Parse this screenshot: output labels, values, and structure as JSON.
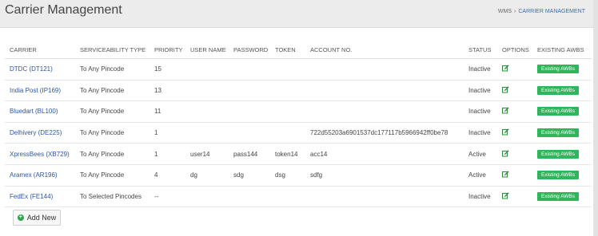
{
  "header": {
    "title": "Carrier Management",
    "breadcrumb": {
      "root": "WMS",
      "separator": "›",
      "current": "CARRIER MANAGEMENT"
    }
  },
  "table": {
    "columns": [
      "CARRIER",
      "SERVICEABILITY TYPE",
      "PRIORITY",
      "USER NAME",
      "PASSWORD",
      "TOKEN",
      "ACCOUNT NO.",
      "STATUS",
      "OPTIONS",
      "EXISTING AWBS"
    ],
    "rows": [
      {
        "carrier": "DTDC (DT121)",
        "serviceability": "To Any Pincode",
        "priority": "15",
        "user_name": "",
        "password": "",
        "token": "",
        "account_no": "",
        "status": "Inactive",
        "awb_label": "Existing AWBs"
      },
      {
        "carrier": "India Post (IP169)",
        "serviceability": "To Any Pincode",
        "priority": "13",
        "user_name": "",
        "password": "",
        "token": "",
        "account_no": "",
        "status": "Inactive",
        "awb_label": "Existing AWBs"
      },
      {
        "carrier": "Bluedart (BL100)",
        "serviceability": "To Any Pincode",
        "priority": "11",
        "user_name": "",
        "password": "",
        "token": "",
        "account_no": "",
        "status": "Inactive",
        "awb_label": "Existing AWBs"
      },
      {
        "carrier": "Delhivery (DE225)",
        "serviceability": "To Any Pincode",
        "priority": "1",
        "user_name": "",
        "password": "",
        "token": "",
        "account_no": "722d55203a6901537dc177117b5966942ff0be78",
        "status": "Inactive",
        "awb_label": "Existing AWBs"
      },
      {
        "carrier": "XpressBees (XB729)",
        "serviceability": "To Any Pincode",
        "priority": "1",
        "user_name": "user14",
        "password": "pass144",
        "token": "token14",
        "account_no": "acc14",
        "status": "Active",
        "awb_label": "Existing AWBs"
      },
      {
        "carrier": "Aramex (AR196)",
        "serviceability": "To Any Pincode",
        "priority": "4",
        "user_name": "dg",
        "password": "sdg",
        "token": "dsg",
        "account_no": "sdfg",
        "status": "Active",
        "awb_label": "Existing AWBs"
      },
      {
        "carrier": "FedEx (FE144)",
        "serviceability": "To Selected Pincodes",
        "priority": "--",
        "user_name": "",
        "password": "",
        "token": "",
        "account_no": "",
        "status": "Inactive",
        "awb_label": "Existing AWBs"
      }
    ]
  },
  "actions": {
    "add_new_label": "Add New"
  },
  "colors": {
    "link": "#2d54a8",
    "awb_button": "#2fb55a",
    "add_icon": "#2fa34f",
    "edit_icon": "#2e8b3e"
  },
  "icons": {
    "options": "edit-icon",
    "add": "plus-circle-icon"
  }
}
